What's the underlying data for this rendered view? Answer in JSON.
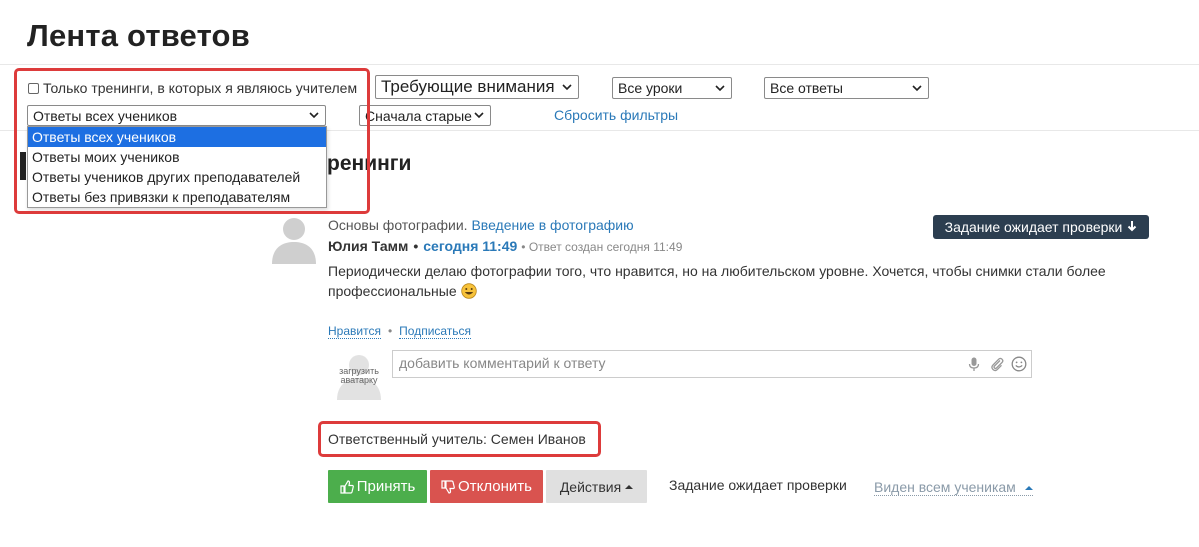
{
  "page": {
    "title": "Лента ответов",
    "section_heading": "ренинги"
  },
  "filters": {
    "only_my_trainings_label": "Только тренинги, в которых я являюсь учителем",
    "attention_select": "Требующие внимания",
    "lessons_select": "Все уроки",
    "answers_select": "Все ответы",
    "students_select": "Ответы всех учеников",
    "order_select": "Сначала старые",
    "reset_label": "Сбросить фильтры"
  },
  "students_dropdown": {
    "options": [
      "Ответы всех учеников",
      "Ответы моих учеников",
      "Ответы учеников других преподавателей",
      "Ответы без привязки к преподавателям"
    ],
    "selected_index": 0
  },
  "answer": {
    "course": "Основы фотографии.",
    "lesson": "Введение в фотографию",
    "status_badge": "Задание ожидает проверки",
    "author": "Юлия Тамм",
    "time": "сегодня 11:49",
    "created": "Ответ создан сегодня 11:49",
    "text": "Периодически делаю фотографии того, что нравится, но на любительском уровне. Хочется, чтобы снимки стали более профессиональные",
    "like_label": "Нравится",
    "subscribe_label": "Подписаться",
    "comment_placeholder": "добавить комментарий к ответу",
    "upload_avatar_label": "загрузить аватарку",
    "responsible": "Ответственный учитель: Семен Иванов",
    "accept_label": "Принять",
    "reject_label": "Отклонить",
    "actions_label": "Действия",
    "status_text": "Задание ожидает проверки",
    "visibility_label": "Виден всем ученикам"
  },
  "colors": {
    "accent_blue": "#2a79b8",
    "accept_green": "#4cae4c",
    "reject_red": "#d9534f",
    "badge_dark": "#2c3e50",
    "highlight_red": "#dd3b3b",
    "dropdown_selected": "#1d6fe2"
  }
}
